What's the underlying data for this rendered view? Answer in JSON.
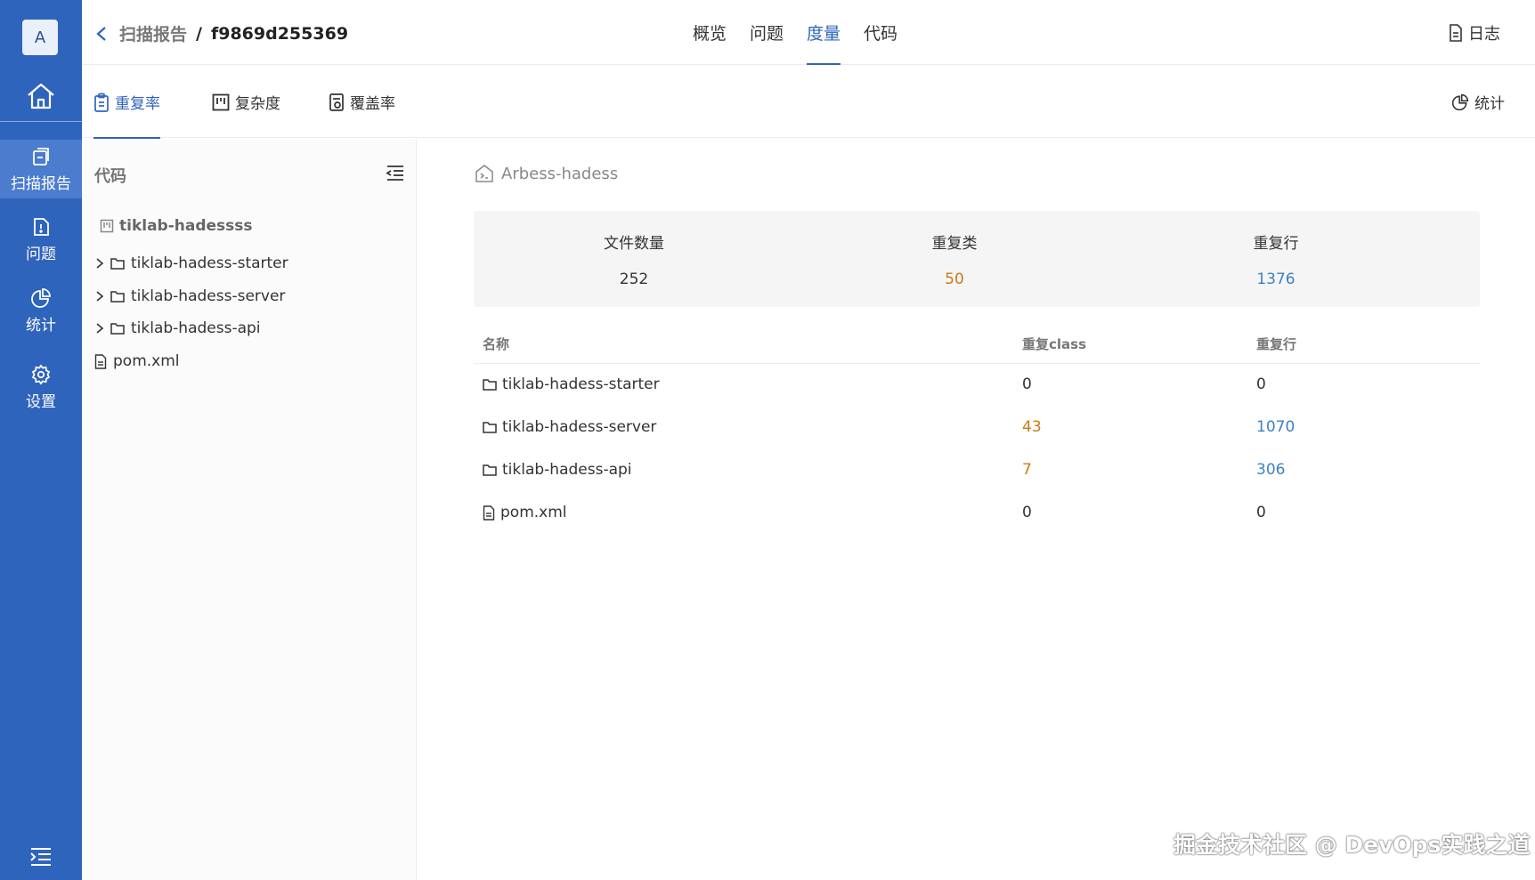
{
  "app": {
    "avatar_letter": "A"
  },
  "leftnav": {
    "items": [
      {
        "label": "扫描报告",
        "icon": "report-icon",
        "active": true
      },
      {
        "label": "问题",
        "icon": "issue-icon",
        "active": false
      },
      {
        "label": "统计",
        "icon": "pie-chart-icon",
        "active": false
      },
      {
        "label": "设置",
        "icon": "gear-icon",
        "active": false
      }
    ]
  },
  "header": {
    "breadcrumb_parent": "扫描报告",
    "breadcrumb_sep": "/",
    "breadcrumb_current": "f9869d255369",
    "tabs": [
      {
        "label": "概览",
        "active": false
      },
      {
        "label": "问题",
        "active": false
      },
      {
        "label": "度量",
        "active": true
      },
      {
        "label": "代码",
        "active": false
      }
    ],
    "log_label": "日志"
  },
  "subtabs": {
    "items": [
      {
        "label": "重复率",
        "active": true
      },
      {
        "label": "复杂度",
        "active": false
      },
      {
        "label": "覆盖率",
        "active": false
      }
    ],
    "stats_label": "统计"
  },
  "tree": {
    "title": "代码",
    "root": "tiklab-hadessss",
    "nodes": [
      {
        "label": "tiklab-hadess-starter",
        "type": "folder"
      },
      {
        "label": "tiklab-hadess-server",
        "type": "folder"
      },
      {
        "label": "tiklab-hadess-api",
        "type": "folder"
      },
      {
        "label": "pom.xml",
        "type": "file"
      }
    ]
  },
  "main": {
    "project": "Arbess-hadess",
    "summary": [
      {
        "label": "文件数量",
        "value": "252",
        "color": "#333333"
      },
      {
        "label": "重复类",
        "value": "50",
        "color": "#c97a16"
      },
      {
        "label": "重复行",
        "value": "1376",
        "color": "#3b82c4"
      }
    ],
    "table": {
      "headers": [
        "名称",
        "重复class",
        "重复行"
      ],
      "rows": [
        {
          "name": "tiklab-hadess-starter",
          "type": "folder",
          "dup_class": "0",
          "dup_lines": "0"
        },
        {
          "name": "tiklab-hadess-server",
          "type": "folder",
          "dup_class": "43",
          "dup_lines": "1070"
        },
        {
          "name": "tiklab-hadess-api",
          "type": "folder",
          "dup_class": "7",
          "dup_lines": "306"
        },
        {
          "name": "pom.xml",
          "type": "file",
          "dup_class": "0",
          "dup_lines": "0"
        }
      ]
    }
  },
  "colors": {
    "accent": "#2f64bc",
    "warn": "#c97a16",
    "info": "#3b82c4"
  },
  "watermark": "掘金技术社区 @ DevOps实践之道"
}
